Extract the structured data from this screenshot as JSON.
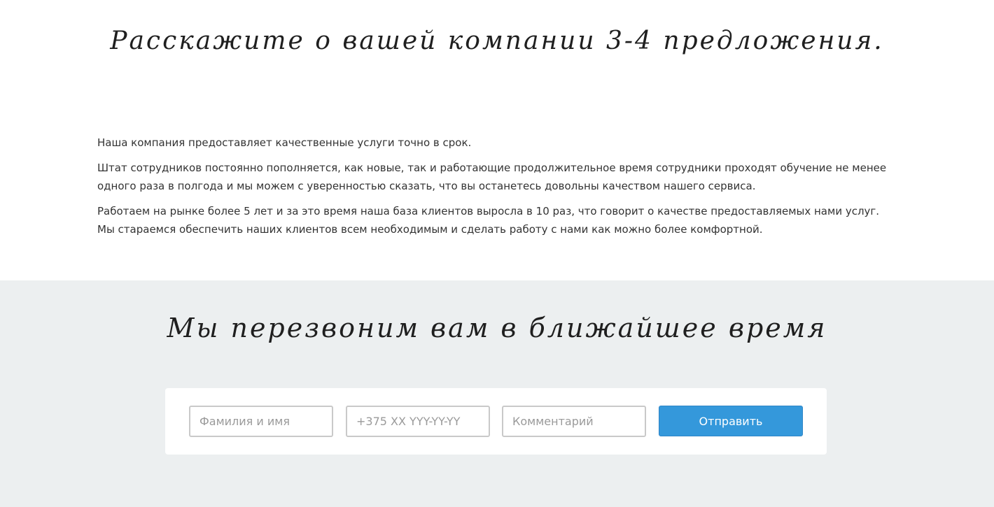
{
  "about": {
    "title": "Расскажите о вашей компании 3-4 предложения.",
    "paragraphs": [
      "Наша компания предоставляет качественные услуги точно в срок.",
      "Штат сотрудников постоянно пополняется, как новые, так и работающие продолжительное время сотрудники проходят обучение не менее одного раза в полгода и мы можем с уверенностью сказать, что вы останетесь довольны качеством нашего сервиса.",
      "Работаем на рынке более 5 лет и за это время наша база клиентов выросла в 10 раз, что говорит о качестве предоставляемых нами услуг. Мы стараемся обеспечить наших клиентов всем необходимым и сделать работу с нами как можно более комфортной."
    ]
  },
  "callback": {
    "title": "Мы перезвоним вам в ближайшее время",
    "form": {
      "name_placeholder": "Фамилия и имя",
      "phone_placeholder": "+375 XX YYY-YY-YY",
      "comment_placeholder": "Комментарий",
      "submit_label": "Отправить"
    }
  },
  "colors": {
    "accent": "#3498db",
    "section_bg": "#eceff0"
  }
}
